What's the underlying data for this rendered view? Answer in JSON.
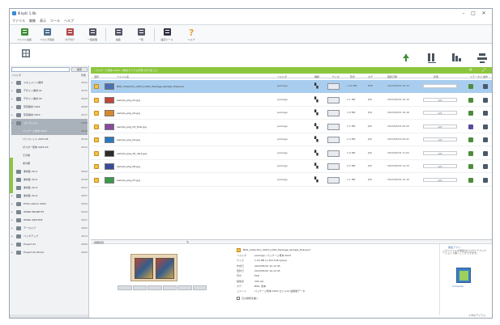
{
  "window": {
    "title": "Ⅲ  kpfc 1.0b",
    "min": "–",
    "max": "□",
    "close": "✕"
  },
  "menu": [
    "ファイル",
    "編集",
    "表示",
    "ツール",
    "ヘルプ"
  ],
  "toolbar": [
    {
      "label": "ファイル追加",
      "icon": "add-file-icon",
      "color": "#3f8f3a"
    },
    {
      "label": "フォルダ追加",
      "icon": "add-folder-icon",
      "color": "#4f6f8f"
    },
    {
      "label": "タグ付け",
      "icon": "tag-icon",
      "color": "#b04a4a"
    },
    {
      "label": "一括処理",
      "icon": "batch-icon",
      "color": "#556"
    },
    {
      "label": "編集",
      "icon": "edit-icon",
      "color": "#556"
    },
    {
      "label": "一覧",
      "icon": "list-icon",
      "color": "#556"
    },
    {
      "label": "設定ツール",
      "icon": "settings-tool-icon",
      "color": "#334"
    },
    {
      "label": "ヘルプ",
      "icon": "help-icon",
      "color": "#e8a23a"
    }
  ],
  "left_panel": {
    "search_placeholder": "",
    "search_button": "検索",
    "header_left": "フォルダ",
    "header_right": "件数",
    "folders": [
      {
        "label": "ドキュメント素材",
        "count": "0041",
        "type": "folder"
      },
      {
        "label": "デザイン素材 01",
        "count": "0015",
        "type": "folder"
      },
      {
        "label": "デザイン素材 02",
        "count": "0020",
        "type": "folder"
      },
      {
        "label": "写真素材 2022",
        "count": "0008",
        "type": "folder"
      },
      {
        "label": "写真素材 2023",
        "count": "0017",
        "type": "folder"
      },
      {
        "label": "コレクション",
        "count": "0009",
        "type": "folder",
        "selected": true
      },
      {
        "label": "パッケージ見本 2023",
        "count": "0009",
        "type": "child",
        "selected": true
      },
      {
        "label": "パンフレット 2023-05",
        "count": "0016",
        "type": "child"
      },
      {
        "label": "ポスター見本 2023-03",
        "count": "0012",
        "type": "child"
      },
      {
        "label": "その他",
        "count": "",
        "type": "child"
      },
      {
        "label": "未分類",
        "count": "",
        "type": "child"
      },
      {
        "label": "素材集 Vol.1",
        "count": "0024",
        "type": "folder"
      },
      {
        "label": "素材集 Vol.2",
        "count": "0018",
        "type": "folder"
      },
      {
        "label": "素材集 Vol.3",
        "count": "0011",
        "type": "folder"
      },
      {
        "label": "素材集 Vol.4",
        "count": "0007",
        "type": "folder"
      },
      {
        "label": "Photo Album 2022",
        "count": "0032",
        "type": "folder"
      },
      {
        "label": "WORK PROJECTS",
        "count": "0019",
        "type": "folder"
      },
      {
        "label": "WORK ARCHIVE",
        "count": "0027",
        "type": "folder"
      },
      {
        "label": "アーカイブ",
        "count": "0005",
        "type": "folder"
      },
      {
        "label": "バックアップ",
        "count": "0013",
        "type": "folder"
      },
      {
        "label": "Project 01",
        "count": "0006",
        "type": "folder"
      },
      {
        "label": "Project 02 (final)",
        "count": "0004",
        "type": "folder"
      }
    ]
  },
  "list": {
    "banner": "パッケージ見本 2023 › 9件のアイテムが見つかりました",
    "headers": [
      "選択",
      "ファイル名",
      "フォルダ",
      "種類",
      "サイズ",
      "形式",
      "タグ",
      "更新日時",
      "状態",
      "ステータス",
      "操作"
    ],
    "rows": [
      {
        "name": "BOX_Collection_2023_Lot01_Package_Sample_final.psd",
        "folder": "package",
        "size": "1.24 MB",
        "format": "PSD",
        "date": "2023/05/02 10:12",
        "progress": "",
        "thumb": "#4c6fb2",
        "selected": true,
        "status_color": "#4e8c3a"
      },
      {
        "name": "sample_pkg_01.jpg",
        "folder": "package",
        "size": "2.1 MB",
        "format": "JPG",
        "date": "2023/05/02 10:15",
        "progress": "3/4",
        "thumb": "#c2463a",
        "selected": false,
        "status_color": "#4e8c3a"
      },
      {
        "name": "sample_pkg_02.jpg",
        "folder": "package",
        "size": "1.8 MB",
        "format": "JPG",
        "date": "2023/05/02 10:18",
        "progress": "2/4",
        "thumb": "#d88a2a",
        "selected": false,
        "status_color": "#4e8c3a"
      },
      {
        "name": "sample_pkg_03_final.jpg",
        "folder": "package",
        "size": "1.5 MB",
        "format": "JPG",
        "date": "2023/05/03 09:20",
        "progress": "4/4",
        "thumb": "#8a4aa0",
        "selected": false,
        "status_color": "#5a4aa0"
      },
      {
        "name": "sample_pkg_04.jpg",
        "folder": "package",
        "size": "2.4 MB",
        "format": "JPG",
        "date": "2023/05/03 09:41",
        "progress": "1/4",
        "thumb": "#2a7ac0",
        "selected": false,
        "status_color": "#4e8c3a"
      },
      {
        "name": "sample_pkg_05_dark.jpg",
        "folder": "package",
        "size": "1.9 MB",
        "format": "JPG",
        "date": "2023/05/03 11:02",
        "progress": "3/4",
        "thumb": "#2b2b2b",
        "selected": false,
        "status_color": "#4e8c3a"
      },
      {
        "name": "sample_pkg_06.jpg",
        "folder": "package",
        "size": "2.2 MB",
        "format": "JPG",
        "date": "2023/05/04 14:33",
        "progress": "2/4",
        "thumb": "#3a4a9a",
        "selected": false,
        "status_color": "#4e8c3a"
      },
      {
        "name": "sample_pkg_07.jpg",
        "folder": "package",
        "size": "1.1 MB",
        "format": "JPG",
        "date": "2023/05/04 15:10",
        "progress": "4/4",
        "thumb": "#3a9a4a",
        "selected": false,
        "status_color": "#4e8c3a"
      }
    ]
  },
  "detail": {
    "header": "詳細情報",
    "file_title": "BOX_Collection_2023_Lot01_Package_Sample_final.psd",
    "fields": [
      {
        "k": "フォルダ",
        "v": "package / パッケージ見本 2023"
      },
      {
        "k": "サイズ",
        "v": "1.24 MB (1,302,528 bytes)"
      },
      {
        "k": "作成日",
        "v": "2023/05/02 10:12:45"
      },
      {
        "k": "更新日",
        "v": "2023/05/02 10:12:45"
      },
      {
        "k": "形式",
        "v": "PSD"
      },
      {
        "k": "解像度",
        "v": "300 dpi"
      },
      {
        "k": "タグ",
        "v": "BOX, 見本"
      },
      {
        "k": "コメント",
        "v": "パッケージ見本 2023 ロット01 最終版データ"
      }
    ],
    "open_link": "元の場所を開く",
    "side_title": "関連アプリ",
    "side_desc": "このファイルを関連付けられたアプリケーションで開くことができます。",
    "side_app": "Compose"
  },
  "status": "9 件のアイテム"
}
